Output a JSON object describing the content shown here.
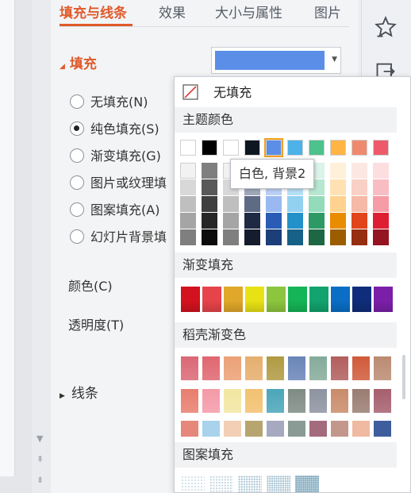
{
  "tabs": [
    {
      "label": "填充与线条",
      "active": true
    },
    {
      "label": "效果",
      "active": false
    },
    {
      "label": "大小与属性",
      "active": false
    },
    {
      "label": "图片",
      "active": false
    }
  ],
  "fill_section": {
    "title": "填充",
    "current_color": "#5B8EE6",
    "options": [
      {
        "label": "无填充(N)",
        "checked": false
      },
      {
        "label": "纯色填充(S)",
        "checked": true
      },
      {
        "label": "渐变填充(G)",
        "checked": false
      },
      {
        "label": "图片或纹理填",
        "checked": false
      },
      {
        "label": "图案填充(A)",
        "checked": false
      },
      {
        "label": "幻灯片背景填",
        "checked": false
      }
    ],
    "color_label": "颜色(C)",
    "transparency_label": "透明度(T)"
  },
  "line_section": {
    "title": "线条"
  },
  "right_toolbar": {
    "icons": [
      "star-icon",
      "export-icon"
    ]
  },
  "popup": {
    "no_fill_label": "无填充",
    "theme_colors_title": "主题颜色",
    "theme_top_row": [
      "#FFFFFF",
      "#000000",
      "#FFFFFF",
      "#0E1621",
      "#5B8EE6",
      "#4CB2E8",
      "#4CC28C",
      "#FFB444",
      "#F08A6E",
      "#EE5A6A"
    ],
    "theme_shades": [
      [
        "#F2F2F2",
        "#7F7F7F",
        "#F2F2F2",
        "#D8DCE5",
        "#DCE7FA",
        "#DBF0FA",
        "#DBF3E8",
        "#FFF0DA",
        "#FCE8E2",
        "#FCDEE1"
      ],
      [
        "#D8D8D8",
        "#595959",
        "#D8D8D8",
        "#9EA8BA",
        "#BBD0F5",
        "#B7E0F5",
        "#B7E7D1",
        "#FFE1B4",
        "#F9D0C5",
        "#F8BDC3"
      ],
      [
        "#BFBFBF",
        "#3F3F3F",
        "#BFBFBF",
        "#5E6B85",
        "#99B9F0",
        "#93D1F1",
        "#93DBBA",
        "#FFD28F",
        "#F6B9A8",
        "#F59CA6"
      ],
      [
        "#A5A5A5",
        "#262626",
        "#A5A5A5",
        "#1E2A44",
        "#2A5CB5",
        "#2290C9",
        "#2D9A66",
        "#E98C00",
        "#E0451C",
        "#DE1E33"
      ],
      [
        "#7F7F7F",
        "#0C0C0C",
        "#7F7F7F",
        "#141C2E",
        "#1C3E79",
        "#176086",
        "#1E6744",
        "#9B5D00",
        "#962E12",
        "#941422"
      ]
    ],
    "selected_theme_index": 4,
    "tooltip": "白色, 背景2",
    "gradient_title": "渐变填充",
    "gradient_colors": [
      "#D2121E",
      "#E6434A",
      "#E0A82A",
      "#E8E215",
      "#8CC63E",
      "#15B456",
      "#12A36E",
      "#0A6EC6",
      "#0F2D7A",
      "#7B1FA8"
    ],
    "shell_gradient_title": "稻壳渐变色",
    "shell_row1": [
      "#DA6876",
      "#E06670",
      "#EBA176",
      "#E6AE6D",
      "#B09A42",
      "#6A85B8",
      "#86AB9A",
      "#B25E5E",
      "#D05A3A",
      "#BB8B72"
    ],
    "shell_row2": [
      "#E87E6E",
      "#F49AA8",
      "#F3E6A2",
      "#F2C16F",
      "#4AA6B9",
      "#7E8B84",
      "#8D93A0",
      "#C98B6A",
      "#9A7D72",
      "#A65F6E"
    ],
    "shell_row3": [
      "#E5877A",
      "#A9D2EC",
      "#F3CFB5",
      "#B6A56E",
      "#A7A9C0",
      "#8A9A95",
      "#A46B7C",
      "#C3978C",
      "#F0B9A2",
      "#3D5D9C"
    ],
    "pattern_title": "图案填充"
  }
}
